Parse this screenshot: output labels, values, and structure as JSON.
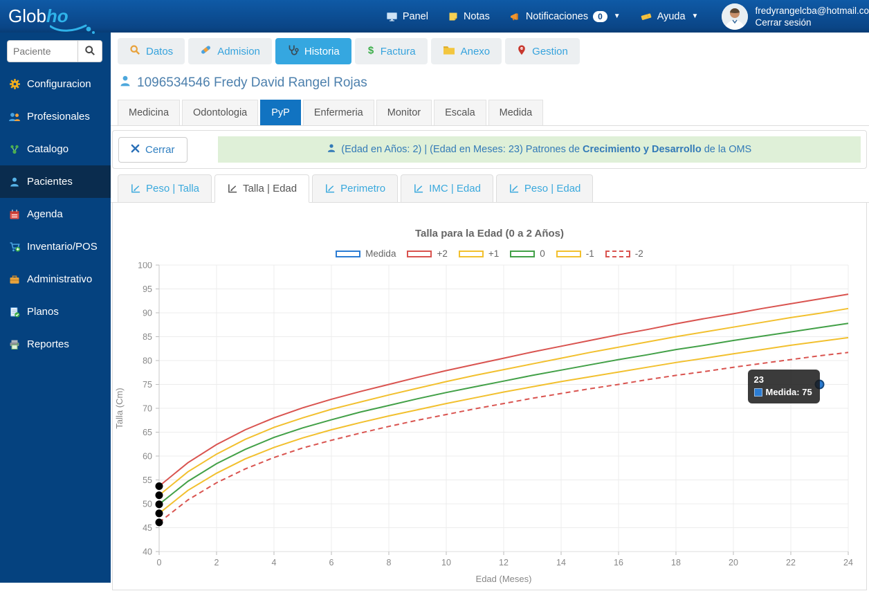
{
  "brand": {
    "part1": "Glob",
    "part2": "ho"
  },
  "topnav": {
    "items": [
      {
        "label": "Panel",
        "icon": "panel-icon"
      },
      {
        "label": "Notas",
        "icon": "notes-icon"
      },
      {
        "label": "Notificaciones",
        "icon": "notifications-icon",
        "badge": "0",
        "caret": true
      },
      {
        "label": "Ayuda",
        "icon": "help-icon",
        "caret": true
      }
    ],
    "user_email": "fredyrangelcba@hotmail.co",
    "logout_label": "Cerrar sesión"
  },
  "sidebar": {
    "search_placeholder": "Paciente",
    "items": [
      {
        "label": "Configuracion",
        "icon": "gear-icon"
      },
      {
        "label": "Profesionales",
        "icon": "professionals-icon"
      },
      {
        "label": "Catalogo",
        "icon": "catalog-icon"
      },
      {
        "label": "Pacientes",
        "icon": "patient-icon",
        "active": true
      },
      {
        "label": "Agenda",
        "icon": "calendar-icon"
      },
      {
        "label": "Inventario/POS",
        "icon": "cart-icon"
      },
      {
        "label": "Administrativo",
        "icon": "briefcase-icon"
      },
      {
        "label": "Planos",
        "icon": "document-check-icon"
      },
      {
        "label": "Reportes",
        "icon": "printer-icon"
      }
    ]
  },
  "main_tabs": [
    {
      "label": "Datos",
      "icon": "search-orange-icon"
    },
    {
      "label": "Admision",
      "icon": "bandage-icon"
    },
    {
      "label": "Historia",
      "icon": "stethoscope-icon",
      "active": true
    },
    {
      "label": "Factura",
      "icon": "dollar-icon"
    },
    {
      "label": "Anexo",
      "icon": "folder-icon"
    },
    {
      "label": "Gestion",
      "icon": "pin-icon"
    }
  ],
  "patient_header": "1096534546 Fredy David Rangel Rojas",
  "section_tabs": [
    {
      "label": "Medicina"
    },
    {
      "label": "Odontologia"
    },
    {
      "label": "PyP",
      "active": true
    },
    {
      "label": "Enfermeria"
    },
    {
      "label": "Monitor"
    },
    {
      "label": "Escala"
    },
    {
      "label": "Medida"
    }
  ],
  "close_button_label": "Cerrar",
  "info_bar": {
    "prefix": "(Edad en Años: 2) | (Edad en Meses: 23) Patrones de ",
    "bold": "Crecimiento y Desarrollo",
    "suffix": " de la OMS"
  },
  "chart_tabs": [
    {
      "label": "Peso | Talla"
    },
    {
      "label": "Talla | Edad",
      "active": true
    },
    {
      "label": "Perimetro"
    },
    {
      "label": "IMC | Edad"
    },
    {
      "label": "Peso | Edad"
    }
  ],
  "chart_data": {
    "type": "line",
    "title": "Talla para la Edad (0 a 2 Años)",
    "xlabel": "Edad (Meses)",
    "ylabel": "Talla (Cm)",
    "xlim": [
      0,
      24
    ],
    "ylim": [
      40,
      100
    ],
    "x_ticks": [
      0,
      2,
      4,
      6,
      8,
      10,
      12,
      14,
      16,
      18,
      20,
      22,
      24
    ],
    "y_ticks": [
      40,
      45,
      50,
      55,
      60,
      65,
      70,
      75,
      80,
      85,
      90,
      95,
      100
    ],
    "grid": true,
    "legend_position": "top",
    "x": [
      0,
      1,
      2,
      3,
      4,
      5,
      6,
      7,
      8,
      9,
      10,
      11,
      12,
      13,
      14,
      15,
      16,
      17,
      18,
      19,
      20,
      21,
      22,
      23,
      24
    ],
    "series": [
      {
        "name": "Medida",
        "color": "#2b7cd3",
        "type": "scatter",
        "points": [
          [
            23,
            75
          ]
        ]
      },
      {
        "name": "+2",
        "color": "#d9534f",
        "dash": false,
        "values": [
          53.7,
          58.6,
          62.4,
          65.5,
          68.0,
          70.1,
          71.9,
          73.5,
          75.0,
          76.5,
          77.9,
          79.2,
          80.5,
          81.8,
          83.0,
          84.2,
          85.4,
          86.5,
          87.7,
          88.8,
          89.8,
          90.9,
          91.9,
          92.9,
          93.9
        ]
      },
      {
        "name": "+1",
        "color": "#f2c02e",
        "dash": false,
        "values": [
          51.8,
          56.7,
          60.4,
          63.5,
          66.0,
          68.0,
          69.8,
          71.3,
          72.8,
          74.2,
          75.6,
          76.9,
          78.1,
          79.3,
          80.5,
          81.7,
          82.8,
          83.9,
          85.0,
          86.0,
          87.0,
          88.0,
          89.0,
          89.9,
          90.9
        ]
      },
      {
        "name": "0",
        "color": "#42a047",
        "dash": false,
        "values": [
          49.9,
          54.7,
          58.4,
          61.4,
          63.9,
          65.9,
          67.6,
          69.2,
          70.6,
          72.0,
          73.3,
          74.5,
          75.7,
          76.9,
          78.0,
          79.1,
          80.2,
          81.2,
          82.3,
          83.2,
          84.2,
          85.1,
          86.0,
          86.9,
          87.8
        ]
      },
      {
        "name": "-1",
        "color": "#f2c02e",
        "dash": false,
        "values": [
          48.0,
          52.8,
          56.4,
          59.4,
          61.8,
          63.8,
          65.5,
          67.0,
          68.4,
          69.7,
          71.0,
          72.2,
          73.4,
          74.5,
          75.6,
          76.6,
          77.6,
          78.6,
          79.6,
          80.5,
          81.4,
          82.3,
          83.2,
          84.0,
          84.8
        ]
      },
      {
        "name": "-2",
        "color": "#d9534f",
        "dash": true,
        "values": [
          46.1,
          50.8,
          54.4,
          57.3,
          59.7,
          61.7,
          63.3,
          64.8,
          66.2,
          67.5,
          68.7,
          69.9,
          71.0,
          72.1,
          73.1,
          74.1,
          75.0,
          76.0,
          76.9,
          77.7,
          78.6,
          79.4,
          80.2,
          81.0,
          81.7
        ]
      }
    ],
    "start_marker_color": "#000000",
    "measure_point": {
      "x": 23,
      "y": 75
    }
  },
  "tooltip": {
    "line1": "23",
    "line2": "Medida: 75",
    "swatch_color": "#2b7cd3"
  },
  "colors": {
    "navbar": "#0a4586",
    "sidebar": "#05427f",
    "sidebar_active": "#0a2c4e",
    "tab_active_blue": "#35a7e0",
    "section_tab_active": "#1173c1",
    "alert_bg": "#dff0d8",
    "alert_text": "#337ab7",
    "link_blue": "#3aa9dd"
  }
}
